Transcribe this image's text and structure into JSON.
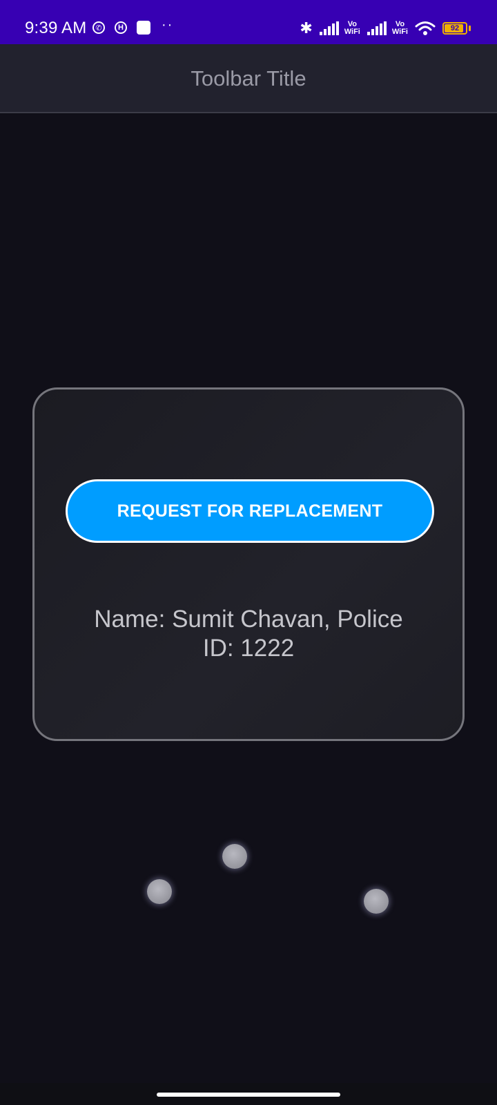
{
  "status_bar": {
    "time": "9:39 AM",
    "left_icons": [
      "whatsapp-icon",
      "h-app-icon",
      "square-app-icon",
      "more-dots-icon"
    ],
    "bluetooth": "bluetooth-icon",
    "vowifi_1_top": "Vo",
    "vowifi_1_bottom": "WiFi",
    "vowifi_2_top": "Vo",
    "vowifi_2_bottom": "WiFi",
    "battery_level": "92",
    "battery_fraction": 0.92,
    "colors": {
      "background": "#3700b3",
      "battery": "#f0b000"
    }
  },
  "toolbar": {
    "title": "Toolbar Title"
  },
  "card": {
    "button_label": "REQUEST FOR REPLACEMENT",
    "info_line_1": "Name: Sumit Chavan, Police",
    "info_line_2": "ID: 1222",
    "colors": {
      "button": "#009dff",
      "border": "#75757c"
    }
  },
  "dots": [
    {
      "name": "dot-1"
    },
    {
      "name": "dot-2"
    },
    {
      "name": "dot-3"
    }
  ]
}
